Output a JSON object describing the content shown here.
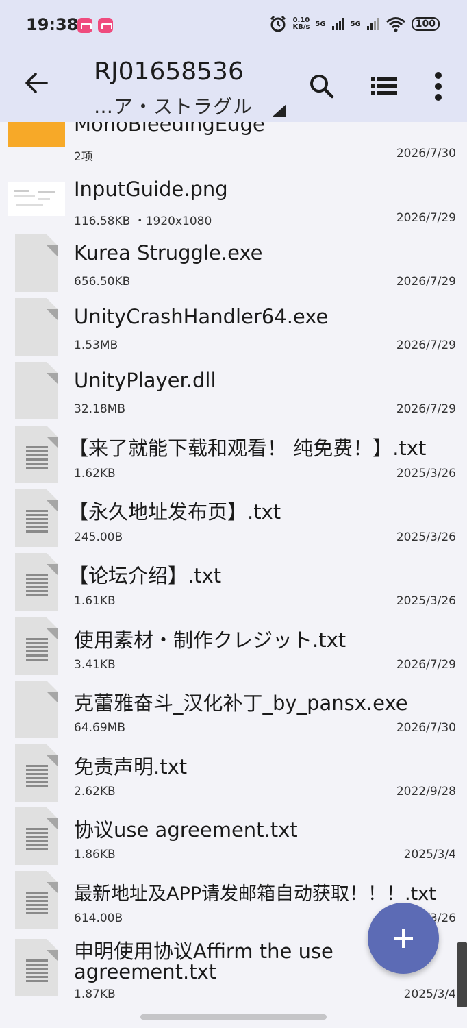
{
  "status_bar": {
    "time": "19:38",
    "speed_value": "0.10",
    "speed_unit": "KB/s",
    "net1": "5G",
    "net2": "5G",
    "battery": "100"
  },
  "app_bar": {
    "title": "RJ01658536",
    "subtitle": "…ア・ストラグル"
  },
  "files": [
    {
      "name": "MonoBleedingEdge",
      "meta": "2项",
      "date": "2026/7/30",
      "kind": "folder"
    },
    {
      "name": "InputGuide.png",
      "meta": "116.58KB  ・1920x1080",
      "date": "2026/7/29",
      "kind": "image"
    },
    {
      "name": "Kurea Struggle.exe",
      "meta": "656.50KB",
      "date": "2026/7/29",
      "kind": "file"
    },
    {
      "name": "UnityCrashHandler64.exe",
      "meta": "1.53MB",
      "date": "2026/7/29",
      "kind": "file"
    },
    {
      "name": "UnityPlayer.dll",
      "meta": "32.18MB",
      "date": "2026/7/29",
      "kind": "file"
    },
    {
      "name": "【来了就能下载和观看！ 纯免费！】.txt",
      "meta": "1.62KB",
      "date": "2025/3/26",
      "kind": "text"
    },
    {
      "name": "【永久地址发布页】.txt",
      "meta": "245.00B",
      "date": "2025/3/26",
      "kind": "text"
    },
    {
      "name": "【论坛介绍】.txt",
      "meta": "1.61KB",
      "date": "2025/3/26",
      "kind": "text"
    },
    {
      "name": "使用素材・制作クレジット.txt",
      "meta": "3.41KB",
      "date": "2026/7/29",
      "kind": "text"
    },
    {
      "name": "克蕾雅奋斗_汉化补丁_by_pansx.exe",
      "meta": "64.69MB",
      "date": "2026/7/30",
      "kind": "file"
    },
    {
      "name": "免责声明.txt",
      "meta": "2.62KB",
      "date": "2022/9/28",
      "kind": "text"
    },
    {
      "name": "协议use agreement.txt",
      "meta": "1.86KB",
      "date": "2025/3/4",
      "kind": "text"
    },
    {
      "name": "最新地址及APP请发邮箱自动获取！！！.txt",
      "meta": "614.00B",
      "date": "2025/3/26",
      "kind": "text"
    },
    {
      "name": "申明使用协议Affirm the use agreement.txt",
      "name_line1": "申明使用协议Affirm the use",
      "name_line2": "agreement.txt",
      "meta": "1.87KB",
      "date": "2025/3/4",
      "kind": "text"
    }
  ],
  "icons": {
    "back": "arrow-back-icon",
    "search": "search-icon",
    "view": "list-view-icon",
    "more": "more-vert-icon",
    "fab": "add-icon"
  },
  "colors": {
    "header_bg": "#e1e4f5",
    "list_bg": "#f3f3f8",
    "folder": "#f7a928",
    "fab": "#5c6bb5"
  }
}
